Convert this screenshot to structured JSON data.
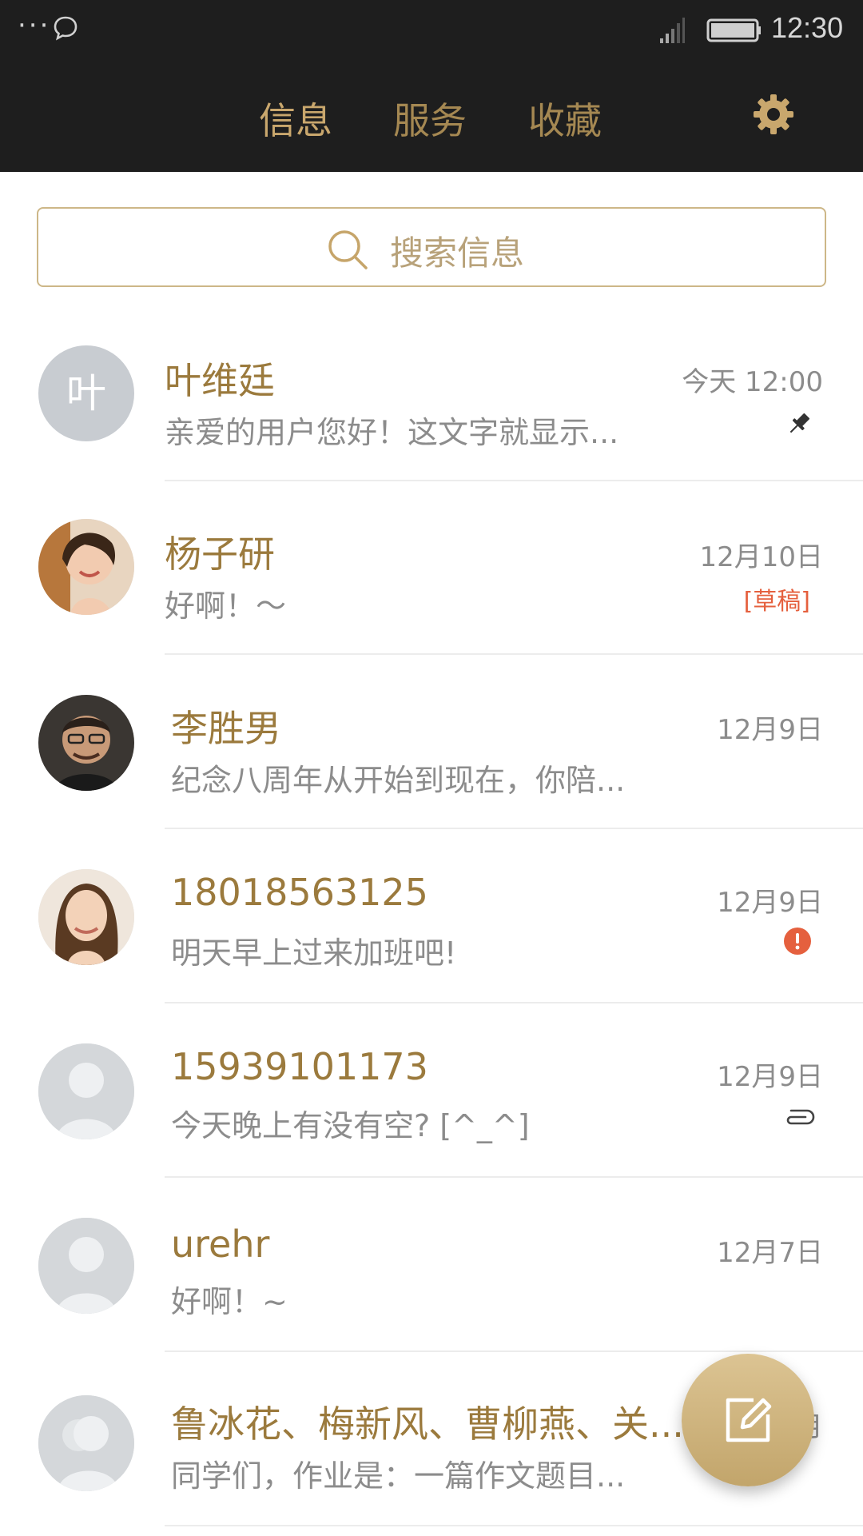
{
  "status_bar": {
    "time": "12:30",
    "left_icons": [
      "more-dots-icon",
      "chat-bubble-icon"
    ],
    "right_icons": [
      "signal-icon",
      "battery-icon"
    ]
  },
  "nav": {
    "tabs": [
      {
        "label": "信息",
        "active": true
      },
      {
        "label": "服务",
        "active": false
      },
      {
        "label": "收藏",
        "active": false
      }
    ],
    "settings_icon": "gear-icon"
  },
  "search": {
    "placeholder": "搜索信息",
    "icon": "search-icon"
  },
  "conversations": [
    {
      "name": "叶维廷",
      "avatar_text": "叶",
      "preview": "亲爱的用户您好！这文字就显示...",
      "date": "今天 12:00",
      "indicator": "pin-icon"
    },
    {
      "name": "杨子研",
      "preview": "好啊！～",
      "date": "12月10日",
      "indicator_text": "[草稿]"
    },
    {
      "name": "李胜男",
      "preview": "纪念八周年从开始到现在，你陪...",
      "date": "12月9日"
    },
    {
      "name": "18018563125",
      "preview": "明天早上过来加班吧!",
      "date": "12月9日",
      "indicator": "alert-icon"
    },
    {
      "name": "15939101173",
      "preview": "今天晚上有没有空? [^_^]",
      "date": "12月9日",
      "indicator": "attachment-icon"
    },
    {
      "name": "urehr",
      "preview": "好啊！~",
      "date": "12月7日"
    },
    {
      "name": "鲁冰花、梅新风、曹柳燕、关...",
      "preview": "同学们，作业是：一篇作文题目...",
      "date": "12月"
    }
  ],
  "fab": {
    "icon": "compose-icon"
  },
  "colors": {
    "accent": "#c9a76d",
    "name": "#9b7a3d",
    "bar": "#1e1e1e",
    "alert": "#e5603e"
  }
}
